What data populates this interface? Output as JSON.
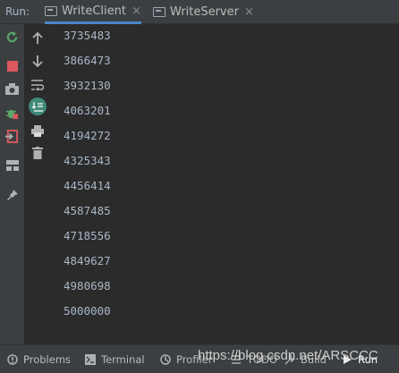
{
  "runbar": {
    "label": "Run:",
    "tabs": [
      {
        "label": "WriteClient",
        "active": true
      },
      {
        "label": "WriteServer",
        "active": false
      }
    ],
    "close_glyph": "×"
  },
  "left_toolbar": [
    "rerun-icon",
    "stop-icon",
    "camera-icon",
    "debug-icon",
    "exit-icon",
    "layout-icon",
    "pin-icon"
  ],
  "console_toolbar": [
    "arrow-up-icon",
    "arrow-down-icon",
    "soft-wrap-icon",
    "scroll-to-end-icon",
    "print-icon",
    "trash-icon"
  ],
  "console": {
    "lines": [
      "3735483",
      "3866473",
      "3932130",
      "4063201",
      "4194272",
      "4325343",
      "4456414",
      "4587485",
      "4718556",
      "4849627",
      "4980698",
      "5000000"
    ]
  },
  "bottom": {
    "problems": "Problems",
    "terminal": "Terminal",
    "profiler": "Profiler",
    "todo": "TODO",
    "build": "Build",
    "run": "Run",
    "watermark": "https://blog.csdn.net/ARSCCC"
  },
  "colors": {
    "accent": "#4a88c7",
    "rerun": "#59a869",
    "stop": "#db5860",
    "scroll_badge": "#3d8a7a"
  }
}
